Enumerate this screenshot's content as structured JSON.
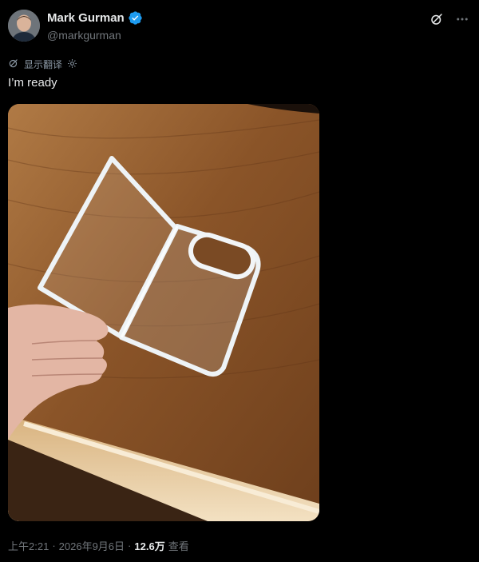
{
  "author": {
    "display_name": "Mark Gurman",
    "handle": "@markgurman",
    "verified_icon": "verified-badge-icon"
  },
  "actions": {
    "grok_icon": "grok-icon",
    "more_icon": "more-icon"
  },
  "translate": {
    "label": "显示翻译",
    "leading_icon": "translate-icon",
    "settings_icon": "settings-icon"
  },
  "tweet": {
    "text": "I’m ready"
  },
  "media": {
    "alt_icon": "photo-of-clear-phone-case"
  },
  "meta": {
    "time": "上午2:21",
    "separator1": "·",
    "date": "2026年9月6日",
    "separator2": "·",
    "views_count": "12.6万",
    "views_label": "查看"
  },
  "colors": {
    "background": "#000000",
    "text_primary": "#e7e9ea",
    "text_secondary": "#71767b",
    "verified": "#1d9bf0"
  }
}
